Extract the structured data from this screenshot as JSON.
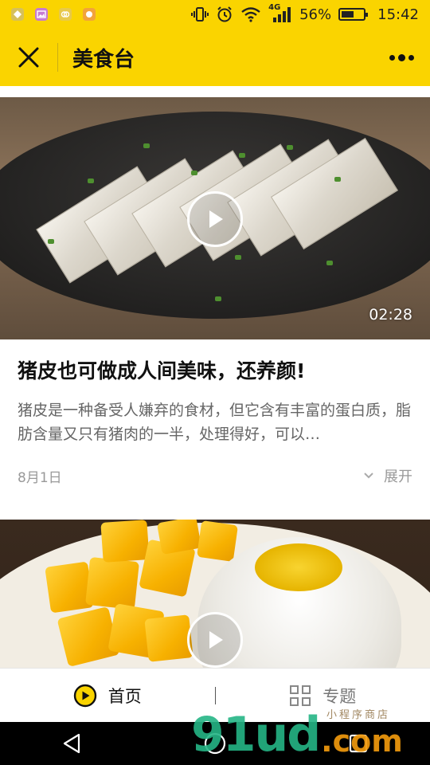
{
  "status_bar": {
    "network": "4G",
    "battery_percent": "56%",
    "battery_level": 0.56,
    "time": "15:42",
    "app_icons": [
      "app-icon-1",
      "gallery-icon",
      "app-icon-2",
      "app-icon-3"
    ]
  },
  "title_bar": {
    "title": "美食台"
  },
  "articles": [
    {
      "duration": "02:28",
      "title": "猪皮也可做成人间美味，还养颜!",
      "description": "猪皮是一种备受人嫌弃的食材，但它含有丰富的蛋白质，脂肪含量又只有猪肉的一半，处理得好，可以…",
      "date": "8月1日",
      "expand_label": "展开"
    },
    {
      "duration": "",
      "title": "",
      "description": "",
      "date": "",
      "expand_label": ""
    }
  ],
  "tab_bar": {
    "tabs": [
      {
        "label": "首页",
        "icon": "play-circle-icon",
        "active": true
      },
      {
        "label": "专题",
        "icon": "grid-icon",
        "active": false
      }
    ]
  },
  "watermark": {
    "main": "91ud",
    "domain": ".com",
    "tagline": "小程序商店"
  },
  "colors": {
    "brand_yellow": "#FAD400",
    "text_dark": "#111111",
    "text_gray": "#666666",
    "meta_gray": "#999999"
  }
}
